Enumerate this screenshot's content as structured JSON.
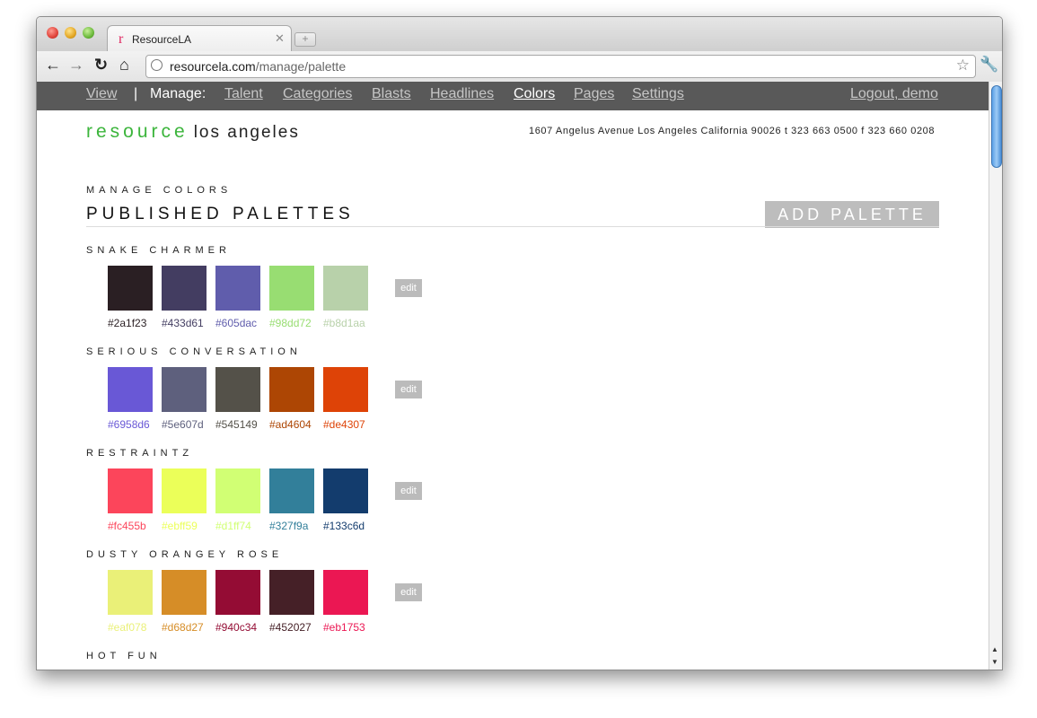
{
  "browser": {
    "tab_title": "ResourceLA",
    "tab_favicon": "r",
    "url_host": "resourcela.com",
    "url_path": "/manage/palette"
  },
  "nav": {
    "view": "View",
    "separator": "|",
    "manage_label": "Manage:",
    "talent": "Talent",
    "categories": "Categories",
    "blasts": "Blasts",
    "headlines": "Headlines",
    "colors": "Colors",
    "pages": "Pages",
    "settings": "Settings",
    "logout": "Logout, demo"
  },
  "header": {
    "logo_green": "resource",
    "logo_black": "los angeles",
    "address": "1607 Angelus Avenue Los Angeles California 90026 t 323 663 0500 f 323 660 0208"
  },
  "page": {
    "kicker": "MANAGE COLORS",
    "title": "PUBLISHED PALETTES",
    "add_button": "ADD PALETTE",
    "edit_label": "edit"
  },
  "palettes": [
    {
      "name": "SNAKE CHARMER",
      "colors": [
        "#2a1f23",
        "#433d61",
        "#605dac",
        "#98dd72",
        "#b8d1aa"
      ]
    },
    {
      "name": "SERIOUS CONVERSATION",
      "colors": [
        "#6958d6",
        "#5e607d",
        "#545149",
        "#ad4604",
        "#de4307"
      ]
    },
    {
      "name": "RESTRAINTZ",
      "colors": [
        "#fc455b",
        "#ebff59",
        "#d1ff74",
        "#327f9a",
        "#133c6d"
      ]
    },
    {
      "name": "DUSTY ORANGEY ROSE",
      "colors": [
        "#eaf078",
        "#d68d27",
        "#940c34",
        "#452027",
        "#eb1753"
      ]
    },
    {
      "name": "HOT FUN",
      "colors": []
    }
  ],
  "icons": {
    "back": "back-arrow-icon",
    "forward": "forward-arrow-icon",
    "reload": "reload-icon",
    "home": "home-icon",
    "globe": "globe-icon",
    "bookmark": "star-icon",
    "settings": "wrench-icon"
  }
}
